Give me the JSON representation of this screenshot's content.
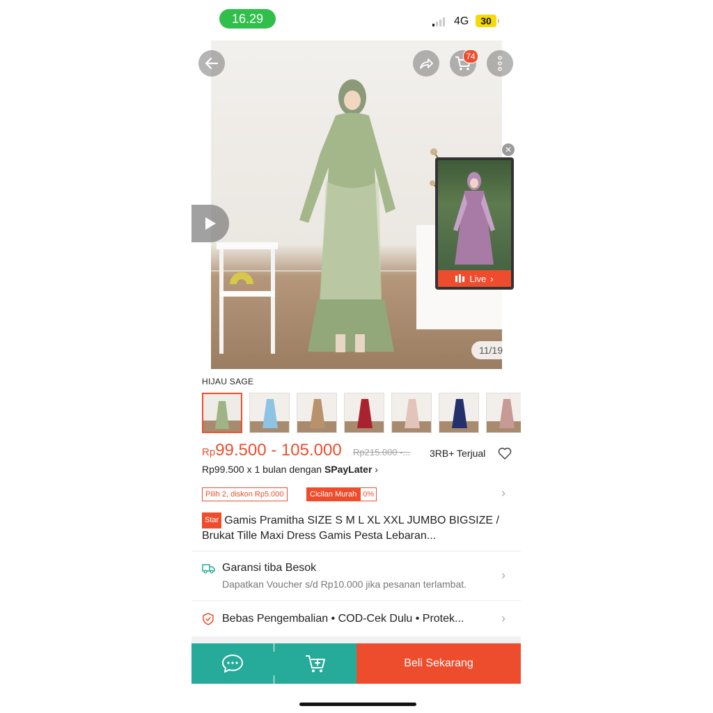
{
  "status_bar": {
    "time": "16.29",
    "network": "4G",
    "battery": "30"
  },
  "header": {
    "cart_badge": "74"
  },
  "gallery": {
    "counter": "11/19"
  },
  "live": {
    "label": "Live"
  },
  "variant": {
    "selected_label": "HIJAU SAGE",
    "thumbs": [
      "sage",
      "light-blue",
      "mocca",
      "maroon",
      "dusty-pink",
      "navy",
      "rose"
    ]
  },
  "product": {
    "currency": "Rp",
    "price_range": "99.500 - 105.000",
    "original_price": "Rp215.000 -...",
    "sold": "3RB+ Terjual",
    "paylater_text": "Rp99.500 x 1 bulan dengan ",
    "paylater_brand": "SPayLater",
    "promo_discount": "Pilih 2, diskon Rp5.000",
    "promo_installment": "Cicilan Murah",
    "promo_installment_rate": "0%",
    "badge": "Star",
    "title": "Gamis Pramitha SIZE S M L XL XXL JUMBO BIGSIZE / Brukat Tille Maxi Dress Gamis Pesta Lebaran..."
  },
  "shipping": {
    "title": "Garansi tiba Besok",
    "subtitle": "Dapatkan Voucher s/d Rp10.000 jika pesanan terlambat."
  },
  "guarantee": {
    "text": "Bebas Pengembalian  •  COD-Cek Dulu  •  Protek..."
  },
  "bottom_bar": {
    "buy_label": "Beli Sekarang"
  },
  "colors": {
    "accent": "#ee4d2d",
    "teal": "#26aa99",
    "status_green": "#2fbf4a"
  }
}
